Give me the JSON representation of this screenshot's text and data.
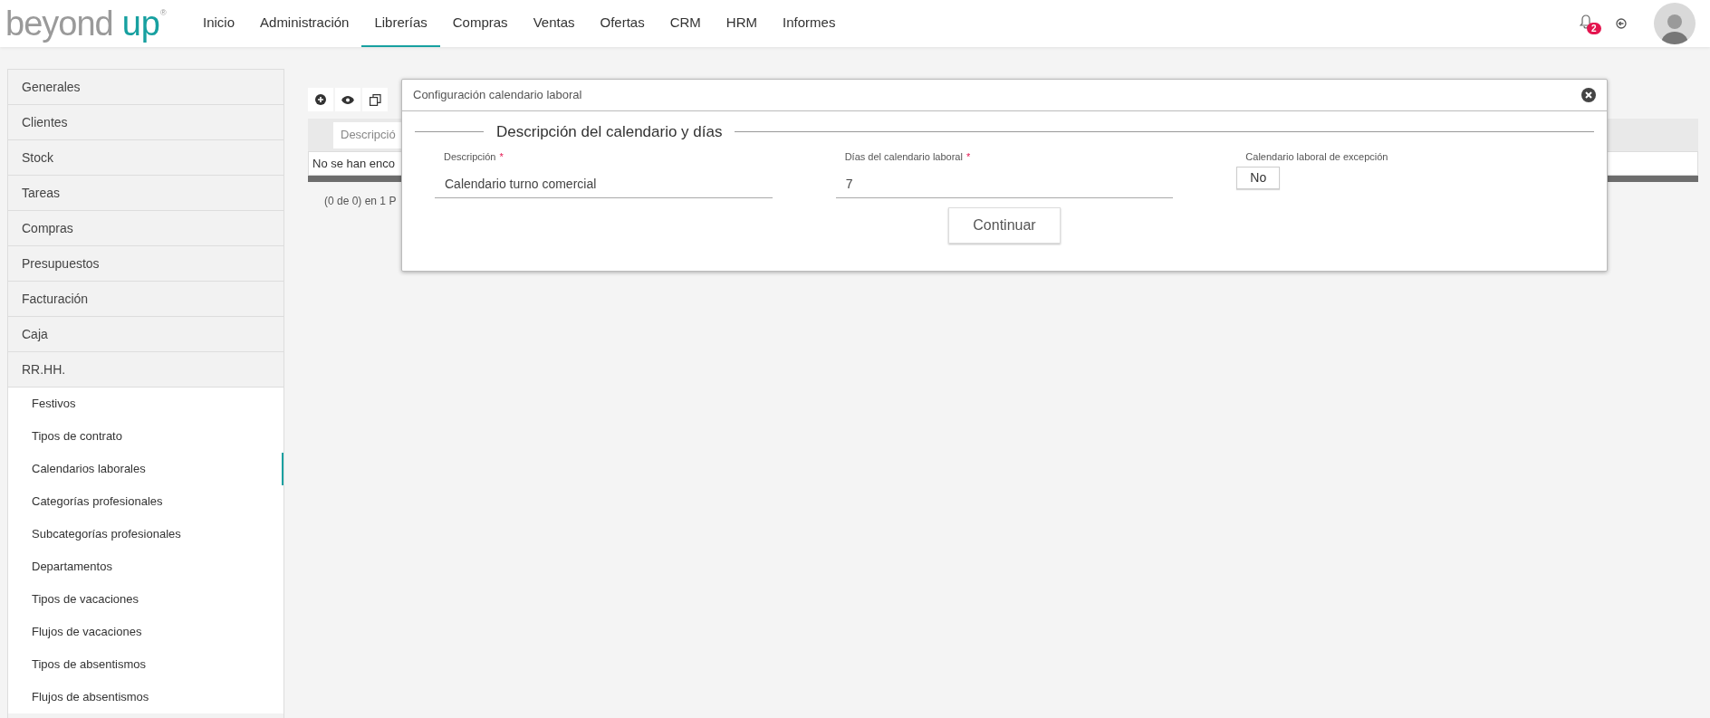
{
  "header": {
    "logo": {
      "word1": "beyond",
      "word2": "up",
      "mark": "®"
    },
    "nav": [
      {
        "label": "Inicio",
        "selected": false
      },
      {
        "label": "Administración",
        "selected": false
      },
      {
        "label": "Librerías",
        "selected": true
      },
      {
        "label": "Compras",
        "selected": false
      },
      {
        "label": "Ventas",
        "selected": false
      },
      {
        "label": "Ofertas",
        "selected": false
      },
      {
        "label": "CRM",
        "selected": false
      },
      {
        "label": "HRM",
        "selected": false
      },
      {
        "label": "Informes",
        "selected": false
      }
    ],
    "notifications": {
      "count": "2"
    }
  },
  "sidebar": {
    "items": [
      {
        "label": "Generales"
      },
      {
        "label": "Clientes"
      },
      {
        "label": "Stock"
      },
      {
        "label": "Tareas"
      },
      {
        "label": "Compras"
      },
      {
        "label": "Presupuestos"
      },
      {
        "label": "Facturación"
      },
      {
        "label": "Caja"
      },
      {
        "label": "RR.HH.",
        "children": [
          {
            "label": "Festivos",
            "selected": false
          },
          {
            "label": "Tipos de contrato",
            "selected": false
          },
          {
            "label": "Calendarios laborales",
            "selected": true
          },
          {
            "label": "Categorías profesionales",
            "selected": false
          },
          {
            "label": "Subcategorías profesionales",
            "selected": false
          },
          {
            "label": "Departamentos",
            "selected": false
          },
          {
            "label": "Tipos de vacaciones",
            "selected": false
          },
          {
            "label": "Flujos de vacaciones",
            "selected": false
          },
          {
            "label": "Tipos de absentismos",
            "selected": false
          },
          {
            "label": "Flujos de absentismos",
            "selected": false
          }
        ]
      }
    ]
  },
  "table": {
    "columns": [
      "Descripció"
    ],
    "empty_message": "No se han enco",
    "paginator": "(0 de 0) en 1 P"
  },
  "dialog": {
    "title": "Configuración calendario laboral",
    "section_title": "Descripción del calendario y días",
    "fields": [
      {
        "kind": "text",
        "label": "Descripción",
        "required_mark": "*",
        "value": "Calendario turno comercial"
      },
      {
        "kind": "text",
        "label": "Días del calendario laboral",
        "required_mark": "*",
        "value": "7"
      },
      {
        "kind": "toggle",
        "label": "Calendario laboral de excepción",
        "value": "No"
      }
    ],
    "buttons": [
      "Continuar"
    ]
  }
}
